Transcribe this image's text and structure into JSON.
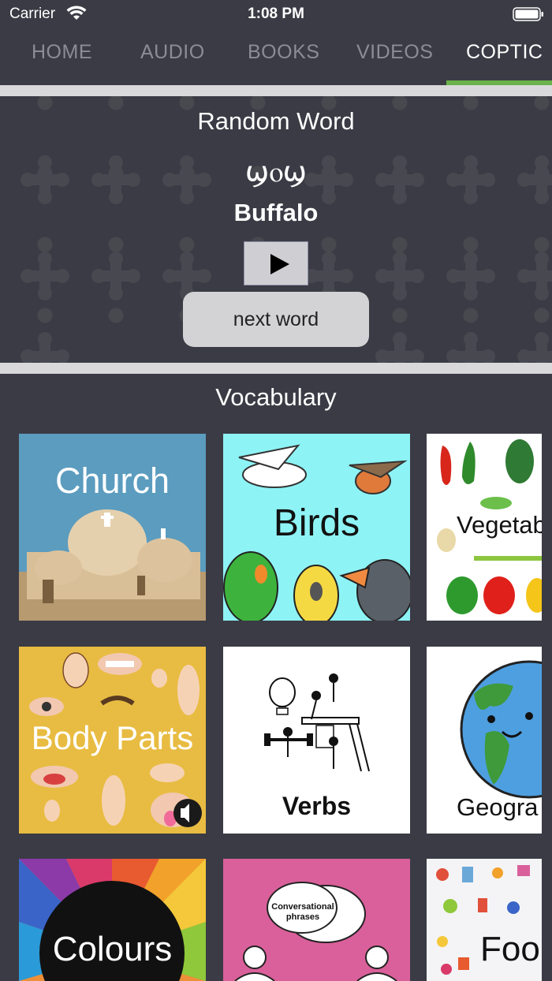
{
  "status": {
    "carrier": "Carrier",
    "time": "1:08 PM"
  },
  "tabs": [
    {
      "label": "HOME"
    },
    {
      "label": "AUDIO"
    },
    {
      "label": "BOOKS"
    },
    {
      "label": "VIDEOS"
    },
    {
      "label": "COPTIC",
      "active": true
    }
  ],
  "random_word": {
    "title": "Random Word",
    "coptic": "ϣⲟϣ",
    "english": "Buffalo",
    "next_label": "next word"
  },
  "vocabulary": {
    "title": "Vocabulary",
    "tiles": [
      {
        "label": "Church"
      },
      {
        "label": "Birds"
      },
      {
        "label": "Vegetab"
      },
      {
        "label": "Body Parts"
      },
      {
        "label": "Verbs"
      },
      {
        "label": "Geogra"
      },
      {
        "label": "Colours"
      },
      {
        "label": "Conversational phrases"
      },
      {
        "label": "Foo"
      }
    ]
  },
  "colors": {
    "background": "#3b3b45",
    "accent": "#6bb24a",
    "inactive_tab": "#8c8c94"
  }
}
